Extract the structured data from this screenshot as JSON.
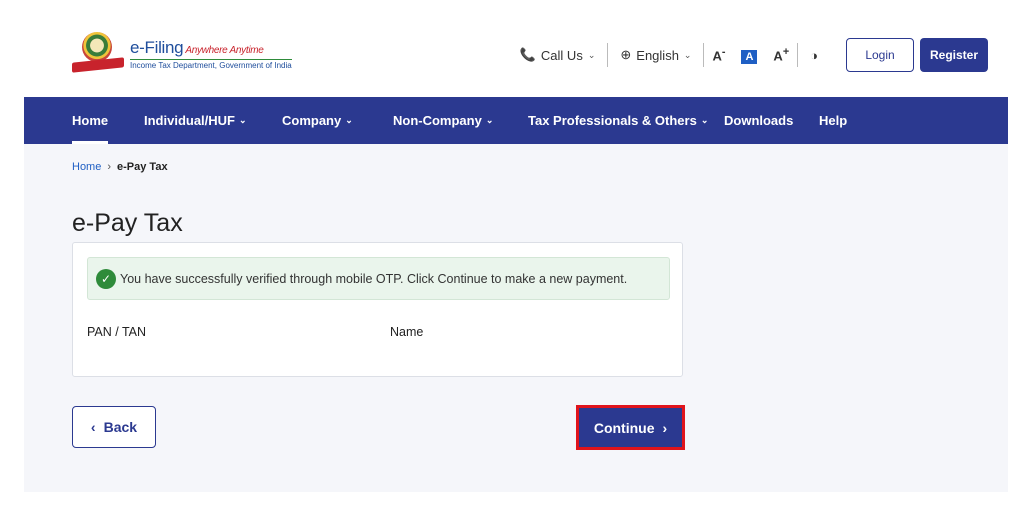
{
  "header": {
    "logo_title": "e-Filing",
    "logo_tagline": "Anywhere Anytime",
    "logo_subtitle": "Income Tax Department, Government of India",
    "call_us": "Call Us",
    "language": "English",
    "font_decrease": "A",
    "font_default": "A",
    "font_increase": "A",
    "login": "Login",
    "register": "Register"
  },
  "nav": {
    "items": [
      {
        "label": "Home",
        "dropdown": false,
        "active": true
      },
      {
        "label": "Individual/HUF",
        "dropdown": true
      },
      {
        "label": "Company",
        "dropdown": true
      },
      {
        "label": "Non-Company",
        "dropdown": true
      },
      {
        "label": "Tax Professionals & Others",
        "dropdown": true
      },
      {
        "label": "Downloads",
        "dropdown": false
      },
      {
        "label": "Help",
        "dropdown": false
      }
    ]
  },
  "breadcrumb": {
    "home": "Home",
    "separator": "›",
    "current": "e-Pay Tax"
  },
  "page": {
    "title": "e-Pay Tax",
    "success_message": "You have successfully verified through mobile OTP. Click Continue to make a new payment.",
    "pan_tan_label": "PAN / TAN",
    "name_label": "Name",
    "back_label": "Back",
    "continue_label": "Continue"
  },
  "colors": {
    "brand_navy": "#2b3990",
    "success_green": "#2e8b3a",
    "highlight_red": "#e0141c",
    "page_bg": "#f5f6fa"
  }
}
